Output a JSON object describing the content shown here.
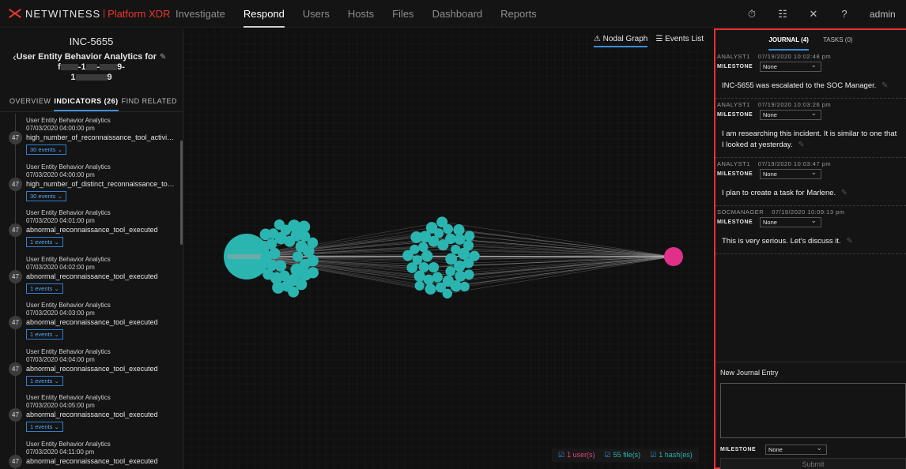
{
  "topnav": {
    "logo_text": "NETWITNESS",
    "logo_sep": "|",
    "logo_sub": "Platform XDR",
    "items": [
      "Investigate",
      "Respond",
      "Users",
      "Hosts",
      "Files",
      "Dashboard",
      "Reports"
    ],
    "active": "Respond",
    "user": "admin",
    "icons": [
      "timer-icon",
      "preferences-icon",
      "tools-icon",
      "help-icon"
    ]
  },
  "incident": {
    "id": "INC-5655",
    "title_line1": "User Entity Behavior Analytics for",
    "title_line2_prefix": "f",
    "title_line2_mid1": "-1",
    "title_line2_mid2": "-",
    "title_line2_suffix": "9-",
    "title_line3_prefix": "1",
    "title_line3_suffix": "9"
  },
  "left_tabs": [
    "OVERVIEW",
    "INDICATORS (26)",
    "FIND RELATED"
  ],
  "indicators": [
    {
      "source": "User Entity Behavior Analytics",
      "time": "07/03/2020 04:00:00 pm",
      "score": "47",
      "name": "high_number_of_reconnaissance_tool_activitie...",
      "events": "30 events"
    },
    {
      "source": "User Entity Behavior Analytics",
      "time": "07/03/2020 04:00:00 pm",
      "score": "47",
      "name": "high_number_of_distinct_reconnaissance_tool...",
      "events": "30 events"
    },
    {
      "source": "User Entity Behavior Analytics",
      "time": "07/03/2020 04:01:00 pm",
      "score": "47",
      "name": "abnormal_reconnaissance_tool_executed",
      "events": "1 events"
    },
    {
      "source": "User Entity Behavior Analytics",
      "time": "07/03/2020 04:02:00 pm",
      "score": "47",
      "name": "abnormal_reconnaissance_tool_executed",
      "events": "1 events"
    },
    {
      "source": "User Entity Behavior Analytics",
      "time": "07/03/2020 04:03:00 pm",
      "score": "47",
      "name": "abnormal_reconnaissance_tool_executed",
      "events": "1 events"
    },
    {
      "source": "User Entity Behavior Analytics",
      "time": "07/03/2020 04:04:00 pm",
      "score": "47",
      "name": "abnormal_reconnaissance_tool_executed",
      "events": "1 events"
    },
    {
      "source": "User Entity Behavior Analytics",
      "time": "07/03/2020 04:05:00 pm",
      "score": "47",
      "name": "abnormal_reconnaissance_tool_executed",
      "events": "1 events"
    },
    {
      "source": "User Entity Behavior Analytics",
      "time": "07/03/2020 04:11:00 pm",
      "score": "47",
      "name": "abnormal_reconnaissance_tool_executed",
      "events": ""
    }
  ],
  "graph": {
    "views": [
      "Nodal Graph",
      "Events List"
    ],
    "active_view": "Nodal Graph",
    "colors": {
      "host": "#2bb5b0",
      "user": "#e0308a",
      "edge": "#8a8a8a"
    },
    "summary": [
      {
        "label": "1 user(s)",
        "kind": "users"
      },
      {
        "label": "55 file(s)",
        "kind": "files"
      },
      {
        "label": "1 hash(es)",
        "kind": "hash"
      }
    ]
  },
  "journal": {
    "tabs": [
      "JOURNAL (4)",
      "TASKS (0)"
    ],
    "active_tab": "JOURNAL (4)",
    "milestone_label": "MILESTONE",
    "entries": [
      {
        "author": "ANALYST1",
        "time": "07/19/2020 10:02:48 pm",
        "milestone": "None",
        "text": "INC-5655 was escalated to the SOC Manager."
      },
      {
        "author": "ANALYST1",
        "time": "07/19/2020 10:03:26 pm",
        "milestone": "None",
        "text": "I am  researching this incident. It is similar to one that I looked at yesterday."
      },
      {
        "author": "ANALYST1",
        "time": "07/19/2020 10:03:47 pm",
        "milestone": "None",
        "text": "I plan to create a task for Marlene."
      },
      {
        "author": "SOCMANAGER",
        "time": "07/19/2020 10:09:13 pm",
        "milestone": "None",
        "text": "This is very serious. Let's discuss it."
      }
    ],
    "new_entry": {
      "label": "New Journal Entry",
      "milestone": "None",
      "submit": "Submit"
    }
  }
}
